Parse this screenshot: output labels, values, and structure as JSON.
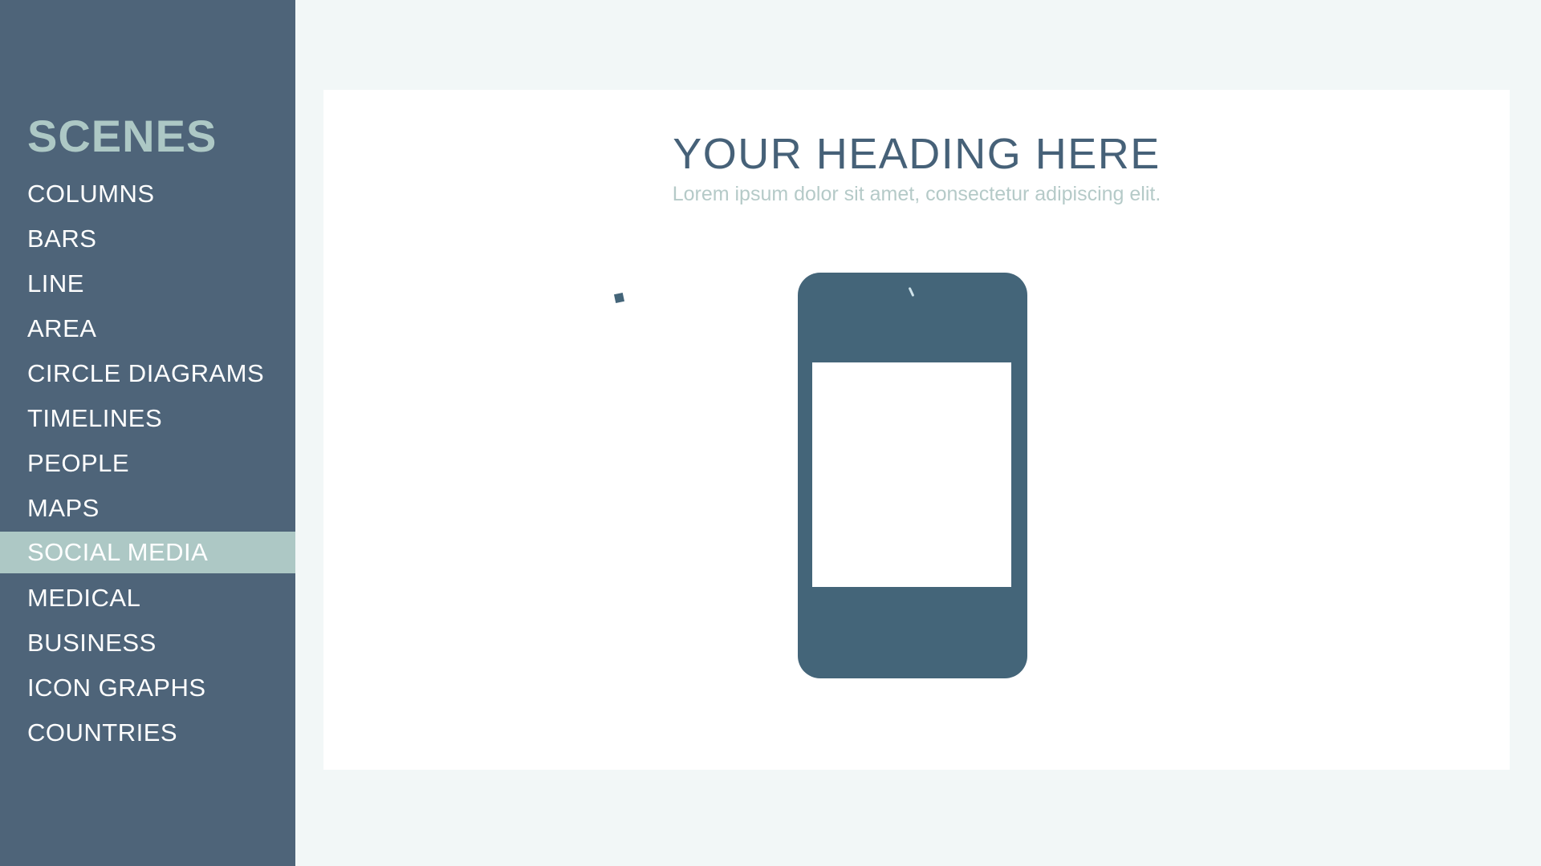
{
  "sidebar": {
    "title": "SCENES",
    "items": [
      {
        "label": "COLUMNS"
      },
      {
        "label": "BARS"
      },
      {
        "label": "LINE"
      },
      {
        "label": "AREA"
      },
      {
        "label": "CIRCLE DIAGRAMS"
      },
      {
        "label": "TIMELINES"
      },
      {
        "label": "PEOPLE"
      },
      {
        "label": "MAPS"
      },
      {
        "label": "SOCIAL MEDIA",
        "active": true
      },
      {
        "label": "MEDICAL"
      },
      {
        "label": "BUSINESS"
      },
      {
        "label": "ICON GRAPHS"
      },
      {
        "label": "COUNTRIES"
      }
    ],
    "active_item": "SOCIAL MEDIA"
  },
  "main": {
    "heading": "YOUR HEADING HERE",
    "subheading": "Lorem ipsum dolor sit amet, consectetur adipiscing elit.",
    "illustration": "smartphone-icon"
  },
  "colors": {
    "sidebar_bg": "#4e6479",
    "accent": "#adc8c5",
    "heading": "#466178",
    "phone": "#446579",
    "page_bg": "#f2f7f7"
  }
}
